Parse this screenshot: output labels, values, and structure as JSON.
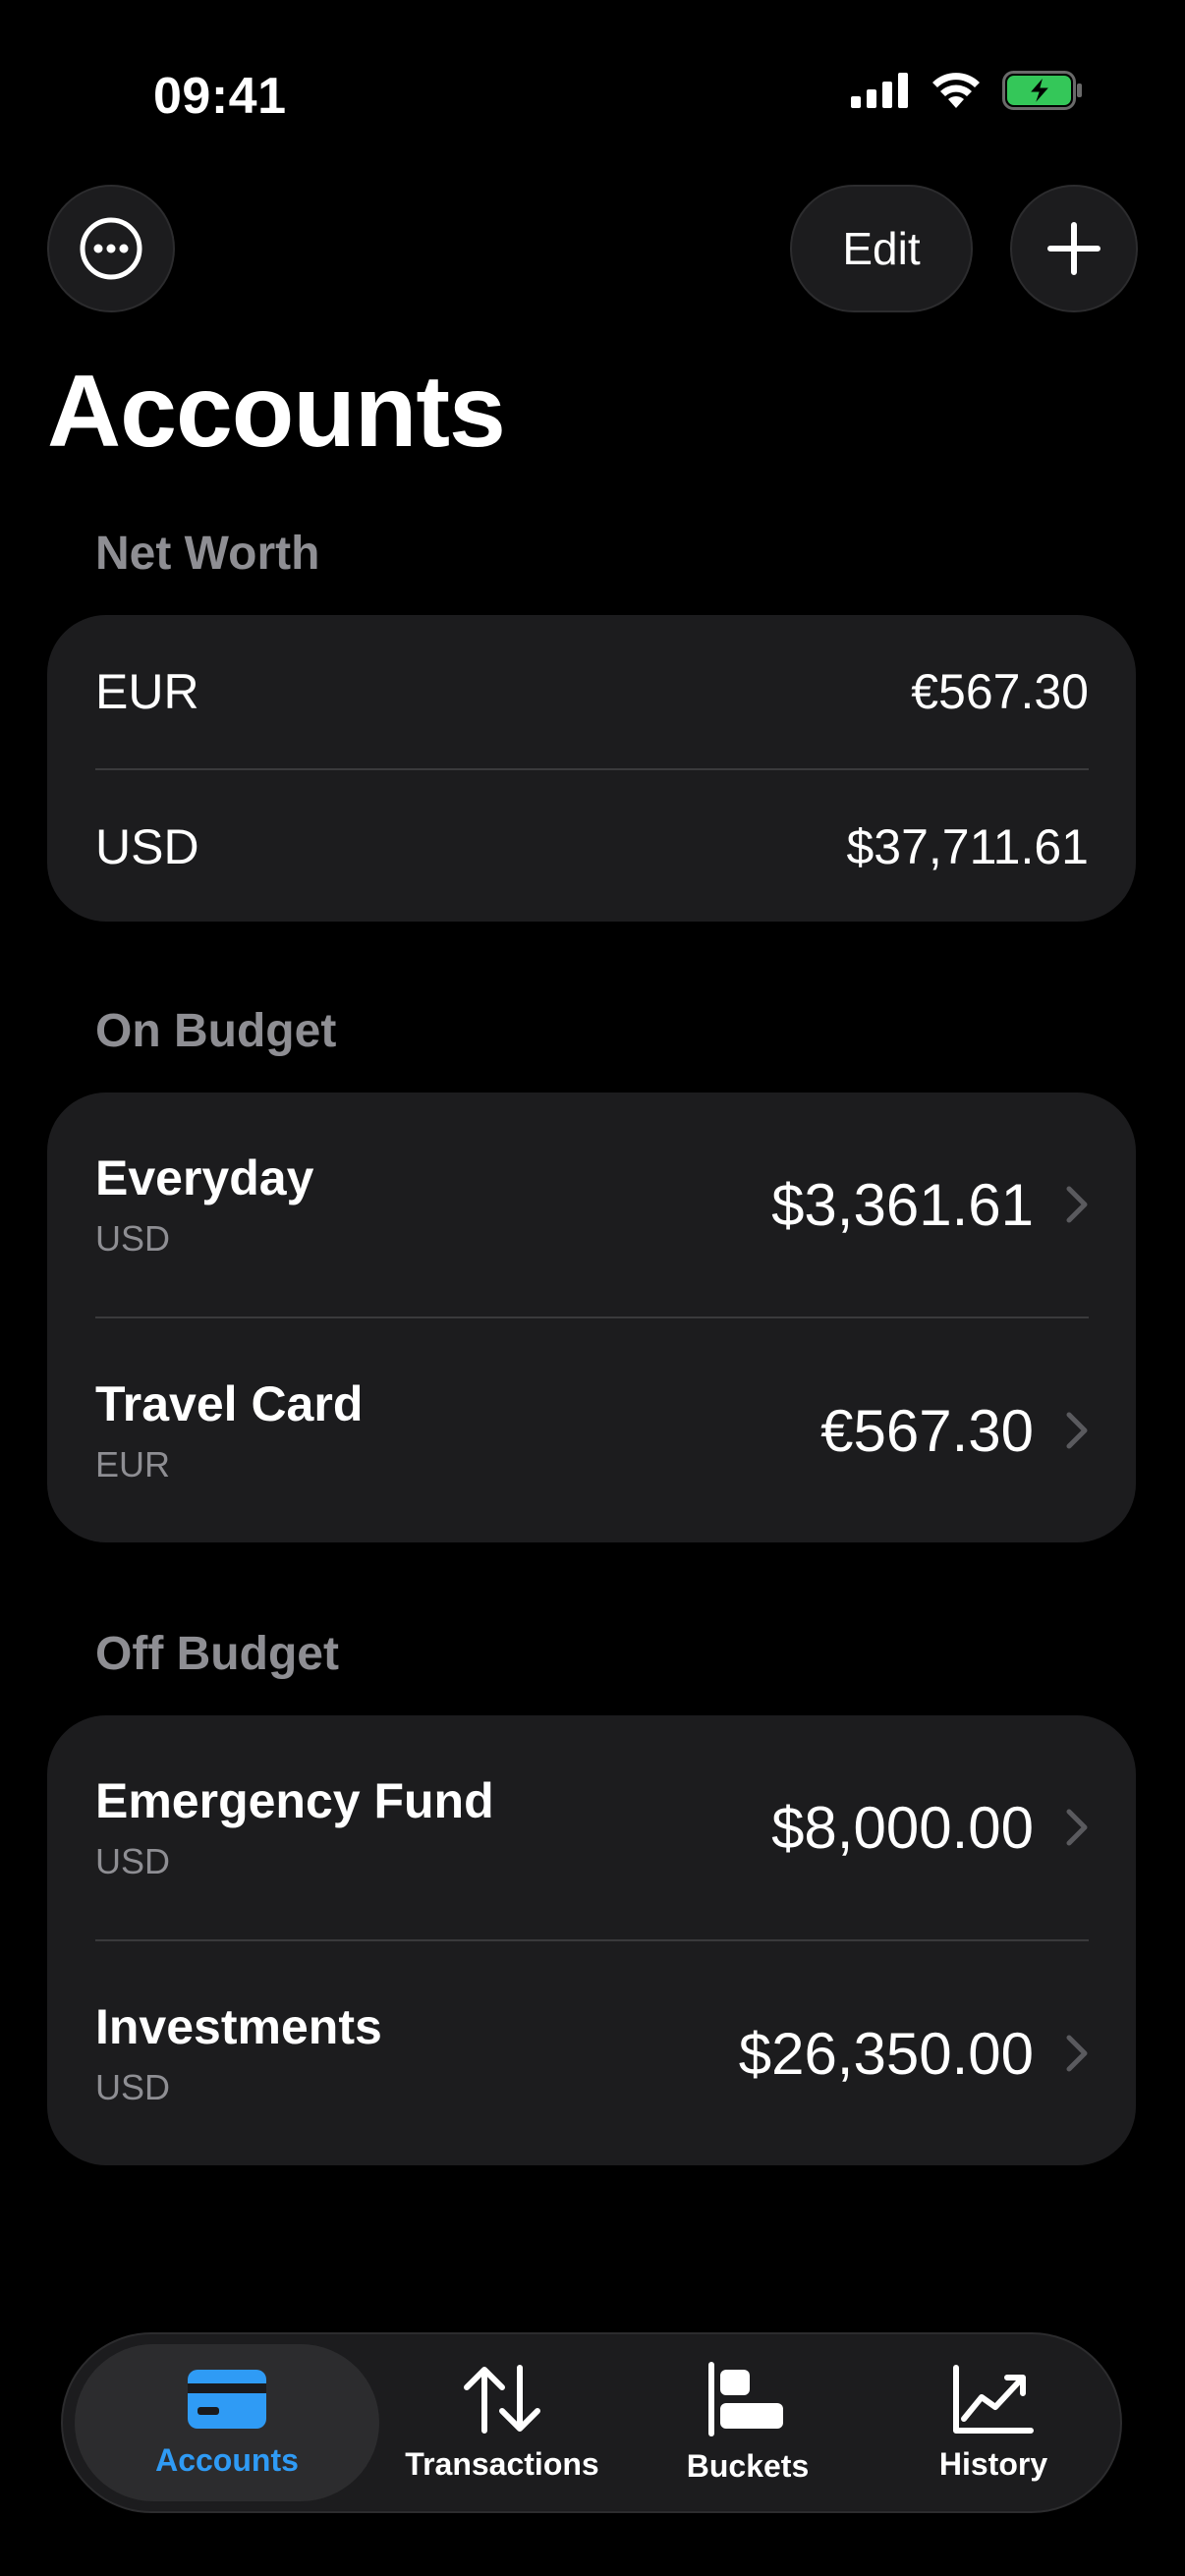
{
  "status": {
    "time": "09:41"
  },
  "toolbar": {
    "edit_label": "Edit"
  },
  "page": {
    "title": "Accounts"
  },
  "net_worth": {
    "header": "Net Worth",
    "rows": [
      {
        "currency": "EUR",
        "amount": "€567.30"
      },
      {
        "currency": "USD",
        "amount": "$37,711.61"
      }
    ]
  },
  "on_budget": {
    "header": "On Budget",
    "accounts": [
      {
        "name": "Everyday",
        "currency": "USD",
        "amount": "$3,361.61"
      },
      {
        "name": "Travel Card",
        "currency": "EUR",
        "amount": "€567.30"
      }
    ]
  },
  "off_budget": {
    "header": "Off Budget",
    "accounts": [
      {
        "name": "Emergency Fund",
        "currency": "USD",
        "amount": "$8,000.00"
      },
      {
        "name": "Investments",
        "currency": "USD",
        "amount": "$26,350.00"
      }
    ]
  },
  "tabs": [
    {
      "label": "Accounts",
      "icon": "credit-card-icon",
      "active": true
    },
    {
      "label": "Transactions",
      "icon": "arrows-up-down-icon",
      "active": false
    },
    {
      "label": "Buckets",
      "icon": "bar-chart-horizontal-icon",
      "active": false
    },
    {
      "label": "History",
      "icon": "line-chart-icon",
      "active": false
    }
  ],
  "colors": {
    "accent": "#2f9bf5",
    "card": "#1c1c1e",
    "secondary_text": "#8e8e93",
    "battery": "#34c759"
  }
}
